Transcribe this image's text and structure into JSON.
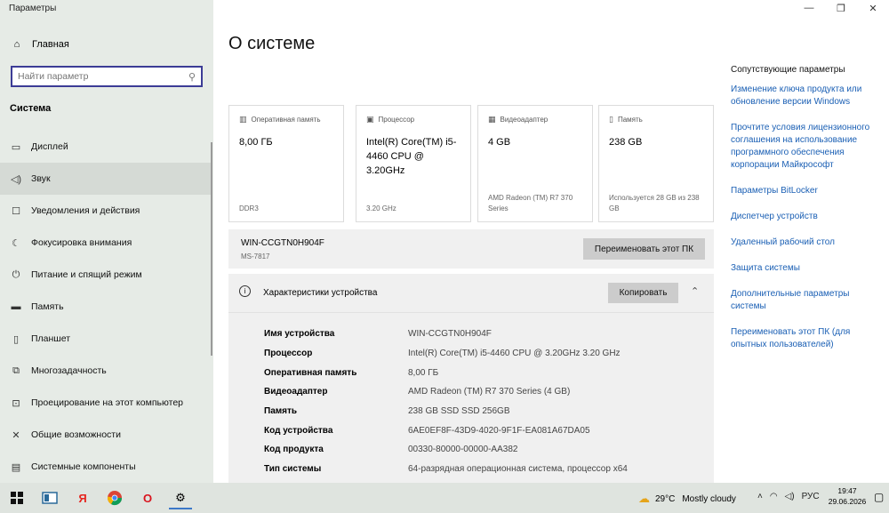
{
  "app_title": "Параметры",
  "window_controls": {
    "minimize": "—",
    "maximize": "❐",
    "close": "✕"
  },
  "sidebar": {
    "home_label": "Главная",
    "search_placeholder": "Найти параметр",
    "section_title": "Система",
    "items": [
      {
        "label": "Дисплей",
        "icon": "display-icon"
      },
      {
        "label": "Звук",
        "icon": "speaker-icon"
      },
      {
        "label": "Уведомления и действия",
        "icon": "notification-icon"
      },
      {
        "label": "Фокусировка внимания",
        "icon": "moon-icon"
      },
      {
        "label": "Питание и спящий режим",
        "icon": "power-icon"
      },
      {
        "label": "Память",
        "icon": "storage-icon"
      },
      {
        "label": "Планшет",
        "icon": "tablet-icon"
      },
      {
        "label": "Многозадачность",
        "icon": "multitasking-icon"
      },
      {
        "label": "Проецирование на этот компьютер",
        "icon": "projection-icon"
      },
      {
        "label": "Общие возможности",
        "icon": "shared-icon"
      },
      {
        "label": "Системные компоненты",
        "icon": "components-icon"
      }
    ]
  },
  "main": {
    "title": "О системе",
    "cards": [
      {
        "header": "Оперативная память",
        "value": "8,00 ГБ",
        "sub": "DDR3",
        "icon": "ram-icon"
      },
      {
        "header": "Процессор",
        "value": "Intel(R) Core(TM) i5-4460  CPU @ 3.20GHz",
        "sub": "3.20 GHz",
        "icon": "cpu-icon"
      },
      {
        "header": "Видеоадаптер",
        "value": "4 GB",
        "sub": "AMD Radeon (TM) R7 370 Series",
        "icon": "gpu-icon"
      },
      {
        "header": "Память",
        "value": "238 GB",
        "sub": "Используется 28 GB из 238 GB",
        "icon": "disk-icon"
      }
    ],
    "pc_name": "WIN-CCGTN0H904F",
    "pc_model": "MS-7817",
    "rename_button": "Переименовать этот ПК",
    "specs": {
      "title": "Характеристики устройства",
      "copy_button": "Копировать",
      "rows": [
        {
          "key": "Имя устройства",
          "value": "WIN-CCGTN0H904F"
        },
        {
          "key": "Процессор",
          "value": "Intel(R) Core(TM) i5-4460  CPU @ 3.20GHz   3.20 GHz"
        },
        {
          "key": "Оперативная память",
          "value": "8,00 ГБ"
        },
        {
          "key": "Видеоадаптер",
          "value": "AMD Radeon (TM) R7 370 Series (4 GB)"
        },
        {
          "key": "Память",
          "value": "238 GB SSD SSD 256GB"
        },
        {
          "key": "Код устройства",
          "value": "6AE0EF8F-43D9-4020-9F1F-EA081A67DA05"
        },
        {
          "key": "Код продукта",
          "value": "00330-80000-00000-AA382"
        },
        {
          "key": "Тип системы",
          "value": "64-разрядная операционная система, процессор x64"
        }
      ]
    }
  },
  "related": {
    "title": "Сопутствующие параметры",
    "links": [
      "Изменение ключа продукта или обновление версии Windows",
      "Прочтите условия лицензионного соглашения на использование программного обеспечения корпорации Майкрософт",
      "Параметры BitLocker",
      "Диспетчер устройств",
      "Удаленный рабочий стол",
      "Защита системы",
      "Дополнительные параметры системы",
      "Переименовать этот ПК (для опытных пользователей)"
    ]
  },
  "taskbar": {
    "temperature": "29°C",
    "condition": "Mostly cloudy",
    "language": "РУС",
    "time": "19:47",
    "date": "29.06.2026",
    "yandex_glyph": "Я",
    "opera_glyph": "O"
  },
  "colors": {
    "link": "#1a5fb4",
    "sidebar_bg": "#e6ebe6",
    "accent": "#3c3c96"
  }
}
